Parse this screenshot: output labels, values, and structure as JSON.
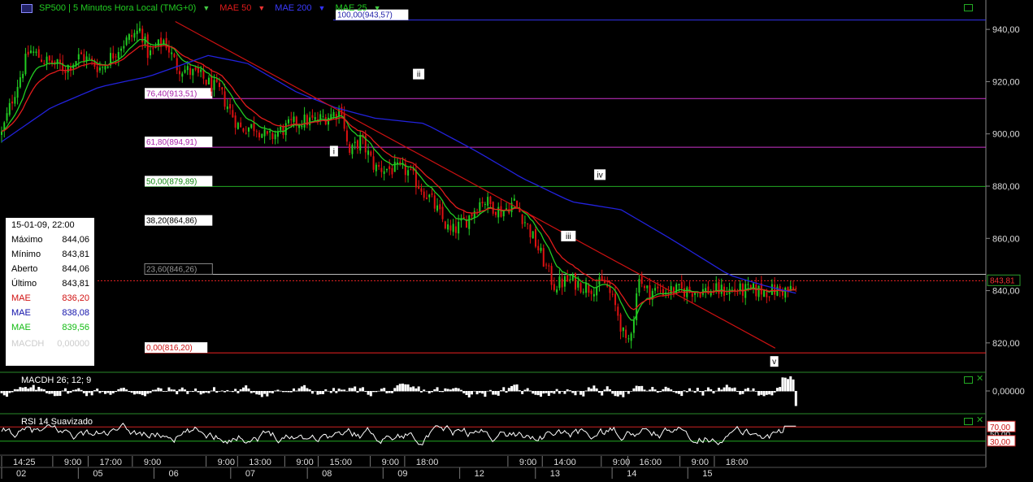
{
  "header": {
    "symbol": "SP500 | 5 Minutos Hora Local (TMG+0)",
    "ind1": "MAE 50",
    "ind2": "MAE 200",
    "ind3": "MAE 25"
  },
  "colors": {
    "background": "#000000",
    "grid": "#333333",
    "mae50": "#e11b1b",
    "mae200": "#2222dd",
    "mae25": "#22cc22",
    "candle_up": "#22cc22",
    "candle_down": "#dd1111",
    "trendline": "#cc1111",
    "fib100": "#3333ee",
    "fib76": "#cc33cc",
    "fib61": "#cc33cc",
    "fib50": "#22aa22",
    "fib23": "#bbbbbb",
    "fib0": "#ee2222",
    "last_price": "#ee2222"
  },
  "infobox": {
    "date": "15-01-09, 22:00",
    "rows": [
      {
        "label": "Máximo",
        "value": "844,06",
        "color": "#000000"
      },
      {
        "label": "Mínimo",
        "value": "843,81",
        "color": "#000000"
      },
      {
        "label": "Aberto",
        "value": "844,06",
        "color": "#000000"
      },
      {
        "label": "Último",
        "value": "843,81",
        "color": "#000000"
      },
      {
        "label": "MAE",
        "value": "836,20",
        "color": "#d11111"
      },
      {
        "label": "MAE",
        "value": "838,08",
        "color": "#1111aa"
      },
      {
        "label": "MAE",
        "value": "839,56",
        "color": "#11bb11"
      }
    ],
    "faded_label": "MACDH",
    "faded_value": "0,00000"
  },
  "chart_data": [
    {
      "type": "candlestick",
      "title": "SP500 | 5 Minutos Hora Local (TMG+0)",
      "ylim": [
        810,
        950
      ],
      "y_ticks": [
        {
          "v": 820,
          "label": "820,00"
        },
        {
          "v": 840,
          "label": "840,00"
        },
        {
          "v": 860,
          "label": "860,00"
        },
        {
          "v": 880,
          "label": "880,00"
        },
        {
          "v": 900,
          "label": "900,00"
        },
        {
          "v": 920,
          "label": "920,00"
        },
        {
          "v": 940,
          "label": "940,00"
        }
      ],
      "last_price": {
        "value": 843.81,
        "label": "843,81"
      },
      "fib_levels": [
        {
          "label": "100,00(943,57)",
          "value": 943.57,
          "color_key": "fib100"
        },
        {
          "label": "76,40(913,51)",
          "value": 913.51,
          "color_key": "fib76"
        },
        {
          "label": "61,80(894,91)",
          "value": 894.91,
          "color_key": "fib61"
        },
        {
          "label": "50,00(879,89)",
          "value": 879.89,
          "color_key": "fib50"
        },
        {
          "label": "38,20(864,86)",
          "value": 864.86,
          "color_key": null
        },
        {
          "label": "23,60(846,26)",
          "value": 846.26,
          "color_key": "fib23"
        },
        {
          "label": "0,00(816,20)",
          "value": 816.2,
          "color_key": "fib0"
        }
      ],
      "wave_labels": [
        {
          "text": "i",
          "t": 0.339,
          "value": 892.0
        },
        {
          "text": "ii",
          "t": 0.425,
          "value": 921.5
        },
        {
          "text": "iii",
          "t": 0.577,
          "value": 859.5
        },
        {
          "text": "iv",
          "t": 0.609,
          "value": 883.0
        },
        {
          "text": "v",
          "t": 0.786,
          "value": 811.5
        }
      ],
      "trendline": [
        {
          "t": 0.178,
          "value": 943.0
        },
        {
          "t": 0.787,
          "value": 818.0
        }
      ],
      "price_path": [
        {
          "t": 0.0,
          "value": 900
        },
        {
          "t": 0.015,
          "value": 915
        },
        {
          "t": 0.035,
          "value": 932
        },
        {
          "t": 0.055,
          "value": 928
        },
        {
          "t": 0.08,
          "value": 925
        },
        {
          "t": 0.1,
          "value": 930
        },
        {
          "t": 0.125,
          "value": 925
        },
        {
          "t": 0.15,
          "value": 934
        },
        {
          "t": 0.175,
          "value": 940
        },
        {
          "t": 0.185,
          "value": 930
        },
        {
          "t": 0.205,
          "value": 936
        },
        {
          "t": 0.22,
          "value": 926
        },
        {
          "t": 0.25,
          "value": 922
        },
        {
          "t": 0.275,
          "value": 916
        },
        {
          "t": 0.3,
          "value": 902
        },
        {
          "t": 0.32,
          "value": 903
        },
        {
          "t": 0.335,
          "value": 898
        },
        {
          "t": 0.35,
          "value": 901
        },
        {
          "t": 0.375,
          "value": 905
        },
        {
          "t": 0.395,
          "value": 905
        },
        {
          "t": 0.42,
          "value": 908
        },
        {
          "t": 0.428,
          "value": 910
        },
        {
          "t": 0.437,
          "value": 892
        },
        {
          "t": 0.452,
          "value": 898
        },
        {
          "t": 0.47,
          "value": 887
        },
        {
          "t": 0.51,
          "value": 886
        },
        {
          "t": 0.54,
          "value": 875
        },
        {
          "t": 0.565,
          "value": 862
        },
        {
          "t": 0.585,
          "value": 867
        },
        {
          "t": 0.605,
          "value": 875
        },
        {
          "t": 0.63,
          "value": 870
        },
        {
          "t": 0.645,
          "value": 874
        },
        {
          "t": 0.66,
          "value": 866
        },
        {
          "t": 0.68,
          "value": 853
        },
        {
          "t": 0.695,
          "value": 842
        },
        {
          "t": 0.715,
          "value": 844
        },
        {
          "t": 0.74,
          "value": 841
        },
        {
          "t": 0.76,
          "value": 843
        },
        {
          "t": 0.775,
          "value": 832
        },
        {
          "t": 0.787,
          "value": 818
        },
        {
          "t": 0.797,
          "value": 832
        },
        {
          "t": 0.803,
          "value": 848
        },
        {
          "t": 0.808,
          "value": 840
        }
      ],
      "mae200_path": [
        {
          "t": 0.0,
          "value": 897
        },
        {
          "t": 0.05,
          "value": 910
        },
        {
          "t": 0.1,
          "value": 918
        },
        {
          "t": 0.15,
          "value": 922
        },
        {
          "t": 0.21,
          "value": 930
        },
        {
          "t": 0.25,
          "value": 927
        },
        {
          "t": 0.3,
          "value": 916
        },
        {
          "t": 0.34,
          "value": 910
        },
        {
          "t": 0.38,
          "value": 906
        },
        {
          "t": 0.43,
          "value": 904
        },
        {
          "t": 0.48,
          "value": 894
        },
        {
          "t": 0.53,
          "value": 883
        },
        {
          "t": 0.58,
          "value": 874
        },
        {
          "t": 0.63,
          "value": 871
        },
        {
          "t": 0.68,
          "value": 860
        },
        {
          "t": 0.74,
          "value": 846
        },
        {
          "t": 0.775,
          "value": 842
        },
        {
          "t": 0.808,
          "value": 839
        }
      ]
    },
    {
      "type": "bar",
      "title": "MACDH 26; 12; 9",
      "y_ticks": [
        {
          "v": 0,
          "label": "0,00000"
        }
      ]
    },
    {
      "type": "line",
      "title": "RSI 14 Suavizado",
      "ylim": [
        0,
        100
      ],
      "y_ticks": [
        {
          "v": 70,
          "label": "70,00"
        },
        {
          "v": 50,
          "label": "50,00"
        },
        {
          "v": 30,
          "label": "30,00"
        }
      ]
    }
  ],
  "time_axis": {
    "upper": [
      {
        "t": 0.0,
        "label": "14:25"
      },
      {
        "t": 0.052,
        "label": "9:00"
      },
      {
        "t": 0.088,
        "label": "17:00"
      },
      {
        "t": 0.133,
        "label": "9:00"
      },
      {
        "t": 0.208,
        "label": "9:00"
      },
      {
        "t": 0.24,
        "label": "13:00"
      },
      {
        "t": 0.288,
        "label": "9:00"
      },
      {
        "t": 0.322,
        "label": "15:00"
      },
      {
        "t": 0.375,
        "label": "9:00"
      },
      {
        "t": 0.41,
        "label": "18:00"
      },
      {
        "t": 0.515,
        "label": "9:00"
      },
      {
        "t": 0.55,
        "label": "14:00"
      },
      {
        "t": 0.61,
        "label": "9:00"
      },
      {
        "t": 0.637,
        "label": "16:00"
      },
      {
        "t": 0.69,
        "label": "9:00"
      },
      {
        "t": 0.725,
        "label": "18:00"
      }
    ],
    "lower": [
      {
        "t": 0.0,
        "label": "02"
      },
      {
        "t": 0.078,
        "label": "05"
      },
      {
        "t": 0.155,
        "label": "06"
      },
      {
        "t": 0.233,
        "label": "07"
      },
      {
        "t": 0.311,
        "label": "08"
      },
      {
        "t": 0.388,
        "label": "09"
      },
      {
        "t": 0.466,
        "label": "12"
      },
      {
        "t": 0.543,
        "label": "13"
      },
      {
        "t": 0.621,
        "label": "14"
      },
      {
        "t": 0.698,
        "label": "15"
      }
    ]
  }
}
